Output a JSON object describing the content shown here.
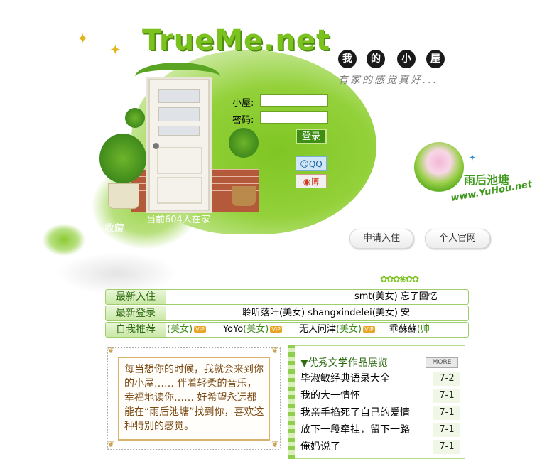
{
  "logo": {
    "text": "TrueMe.net"
  },
  "header": {
    "title_chars": [
      "我",
      "的",
      "小",
      "屋"
    ],
    "slogan": "有家的感觉真好..."
  },
  "login": {
    "house_label": "小屋:",
    "password_label": "密码:",
    "house_value": "",
    "password_value": "",
    "login_button": "登录",
    "qq_button": "QQ",
    "weibo_button": "博"
  },
  "house": {
    "online_text": "当前604人在家",
    "collect_label": "收藏"
  },
  "yuhou": {
    "name": "雨后池塘",
    "url": "www.YuHou.net"
  },
  "actions": {
    "apply": "申请入住",
    "official": "个人官网"
  },
  "lists": {
    "newest": {
      "label": "最新入住",
      "text": "smt(美女)   忘了回忆"
    },
    "login": {
      "label": "最新登录",
      "text": "聆听落叶(美女)   shangxindelei(美女)   安"
    },
    "recommend": {
      "label": "自我推荐",
      "entries": [
        {
          "name": "",
          "tag": "(美女)",
          "vip": "VIP"
        },
        {
          "name": "YoYo",
          "tag": "(美女)",
          "vip": "VIP"
        },
        {
          "name": "无人问津",
          "tag": "(美女)",
          "vip": "VIP"
        },
        {
          "name": "乖蘇蘇",
          "tag": "(帅",
          "vip": ""
        }
      ]
    }
  },
  "quote": {
    "text": "每当想你的时候，我就会来到你的小屋……  伴着轻柔的音乐，幸福地读你……  好希望永远都能在“雨后池塘”找到你，喜欢这种特别的感觉。"
  },
  "literature": {
    "title": "▼优秀文学作品展览",
    "more_label": "MORE",
    "items": [
      {
        "title": "毕淑敏经典语录大全",
        "date": "7-2"
      },
      {
        "title": "我的大一情怀",
        "date": "7-1"
      },
      {
        "title": "我亲手掐死了自己的爱情",
        "date": "7-1"
      },
      {
        "title": "放下一段牵挂，留下一路",
        "date": "7-1"
      },
      {
        "title": "俺妈说了",
        "date": "7-1"
      }
    ]
  },
  "colors": {
    "accent": "#7bc21f",
    "dark_green": "#3f8e14",
    "text_brown": "#7b4a14"
  }
}
